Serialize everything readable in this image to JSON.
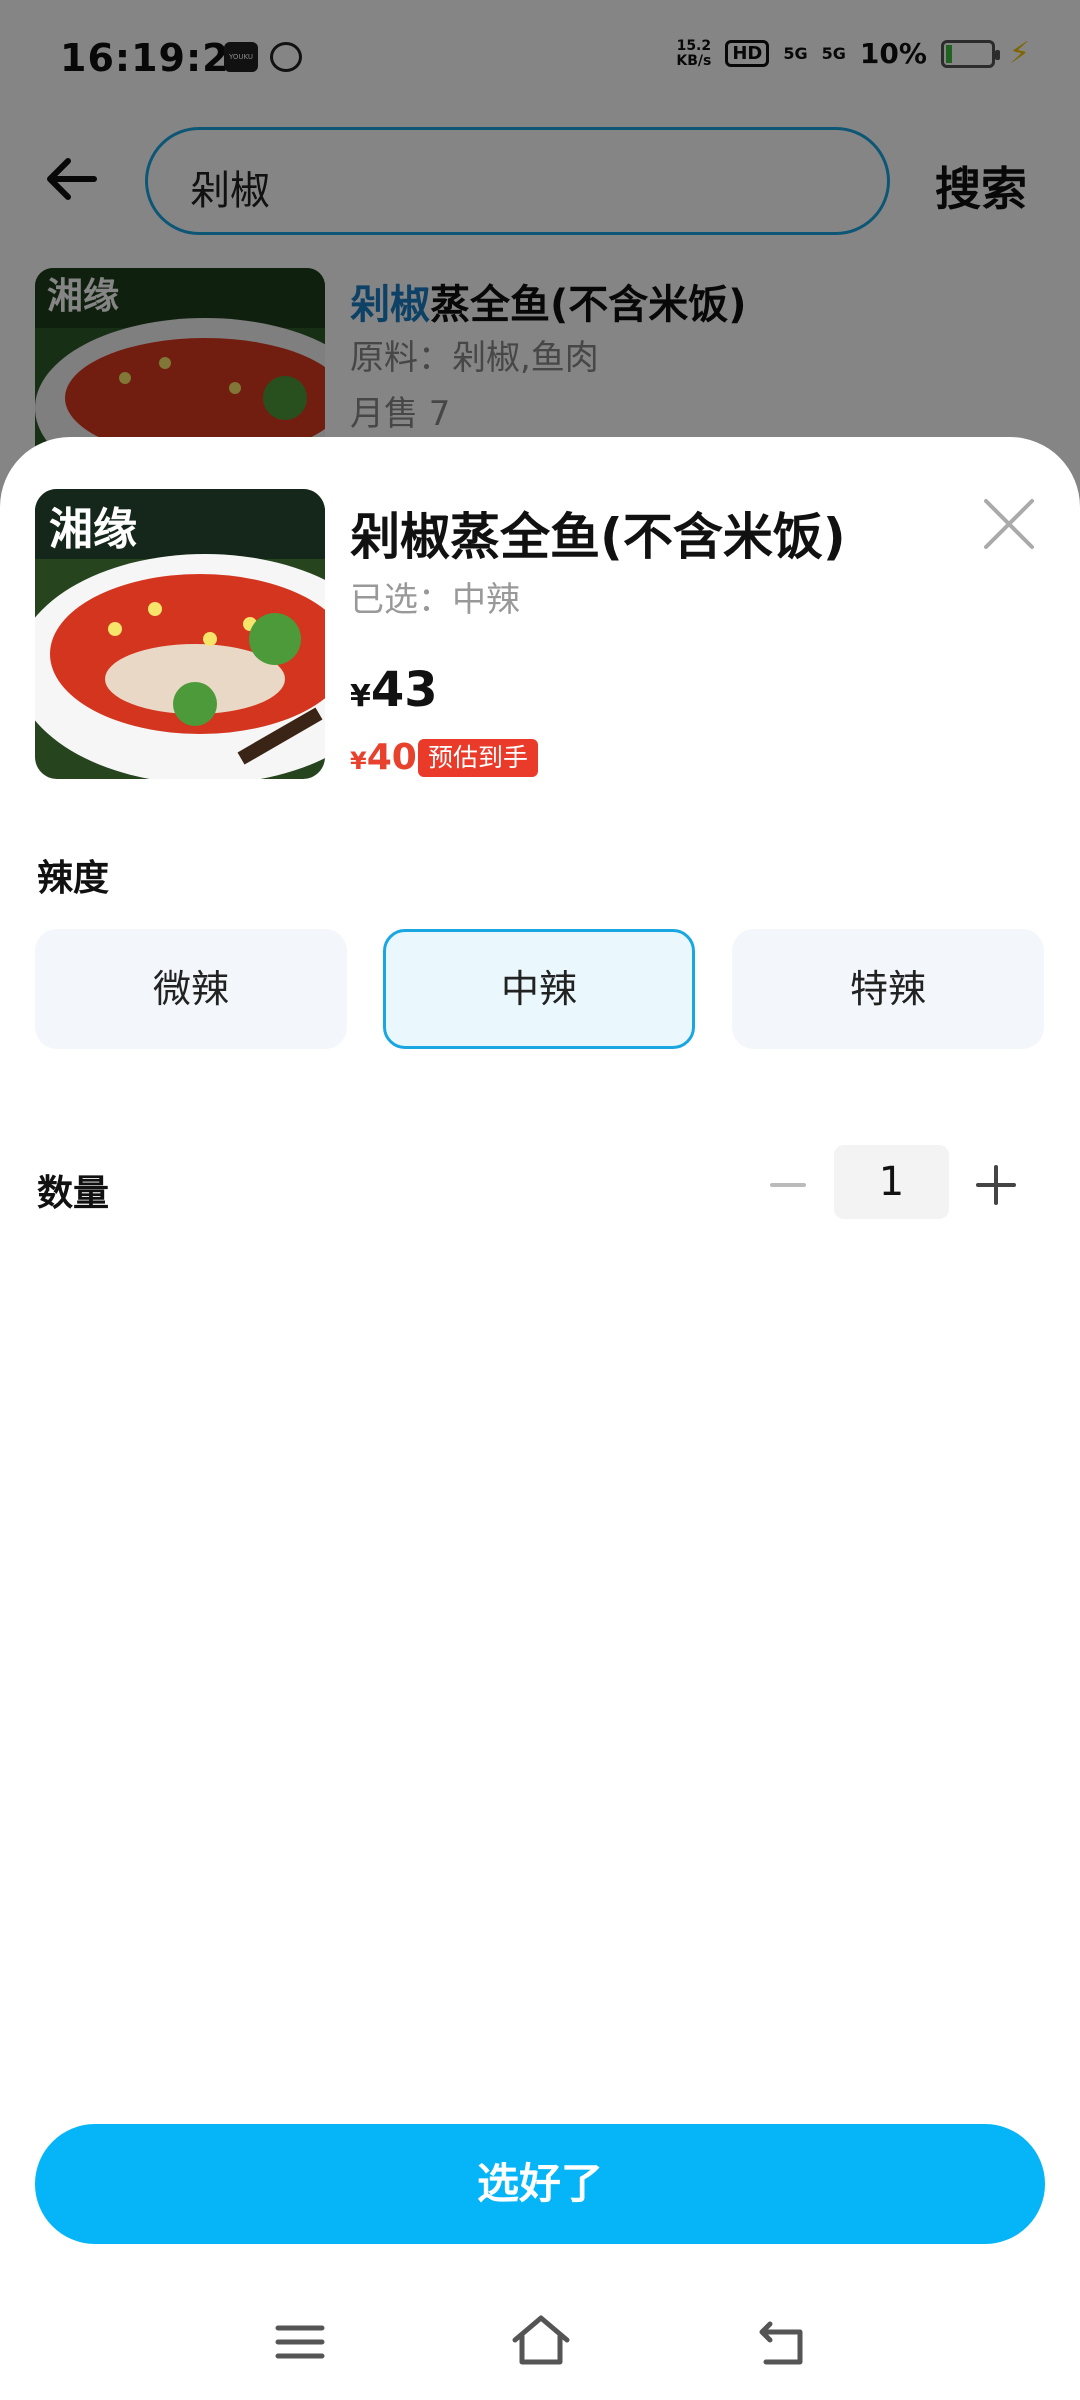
{
  "status_bar": {
    "time": "16:19:24",
    "net_speed_value": "15.2",
    "net_speed_unit": "KB/s",
    "hd": "HD",
    "signal1": "5G",
    "signal2": "5G",
    "battery": "10%",
    "app_icon1_text": "YOUKU"
  },
  "search": {
    "query": "剁椒",
    "button_label": "搜索"
  },
  "result": {
    "title_highlight": "剁椒",
    "title_rest": "蒸全鱼(不含米饭)",
    "ingredients": "原料：剁椒,鱼肉",
    "sales": "月售 7"
  },
  "sheet": {
    "dish_title": "剁椒蒸全鱼(不含米饭)",
    "selected": "已选：中辣",
    "price_symbol": "¥",
    "price": "43",
    "est_price_symbol": "¥",
    "est_price": "40",
    "est_badge": "预估到手",
    "spice_label": "辣度",
    "spice_options": [
      {
        "label": "微辣",
        "selected": false
      },
      {
        "label": "中辣",
        "selected": true
      },
      {
        "label": "特辣",
        "selected": false
      }
    ],
    "quantity_label": "数量",
    "quantity": "1",
    "confirm_label": "选好了"
  },
  "image_text": {
    "logo": "湘缘"
  },
  "colors": {
    "accent": "#05b5f7",
    "highlight": "#1a7fc4",
    "price_red": "#e8412e"
  }
}
